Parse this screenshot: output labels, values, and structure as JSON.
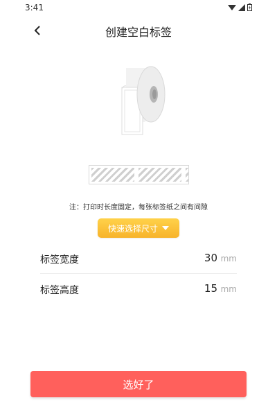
{
  "status": {
    "time": "3:41"
  },
  "header": {
    "title": "创建空白标签"
  },
  "note": "注：打印时长度固定，每张标签纸之间有间隙",
  "quick_select": {
    "label": "快速选择尺寸"
  },
  "fields": [
    {
      "label": "标签宽度",
      "value": "30",
      "unit": "mm"
    },
    {
      "label": "标签高度",
      "value": "15",
      "unit": "mm"
    }
  ],
  "done_button": {
    "label": "选好了"
  },
  "colors": {
    "accent": "#ff605c",
    "quick": "#f7b32b",
    "unit": "#aaaaaa"
  }
}
